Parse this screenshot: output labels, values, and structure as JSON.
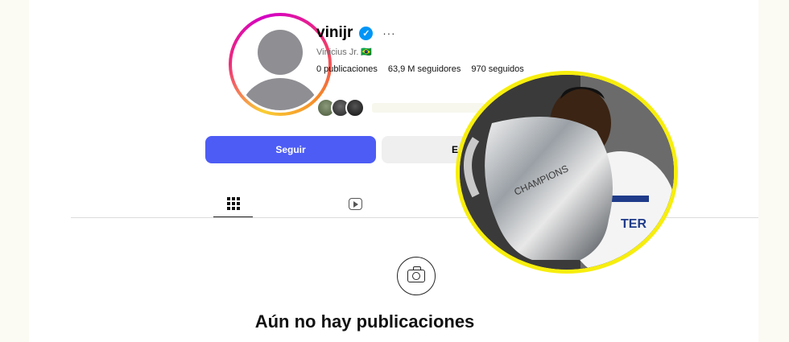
{
  "profile": {
    "username": "vinijr",
    "verified_icon": "verified-check-icon",
    "more_label": "···",
    "full_name": "Vinicius Jr. 🇧🇷",
    "stats": {
      "posts": "0 publicaciones",
      "followers": "63,9 M seguidores",
      "following": "970 seguidos"
    }
  },
  "actions": {
    "follow_label": "Seguir",
    "message_label": "En"
  },
  "tabs": {
    "posts_icon": "grid-icon",
    "reels_icon": "reels-icon"
  },
  "empty_state": {
    "icon": "camera-icon",
    "title": "Aún no hay publicaciones"
  },
  "inset_photo": {
    "description_icon": "trophy-photo",
    "border_color": "#f7ee0e"
  },
  "colors": {
    "follow_button": "#4d5cf5",
    "verified": "#0095f6"
  }
}
